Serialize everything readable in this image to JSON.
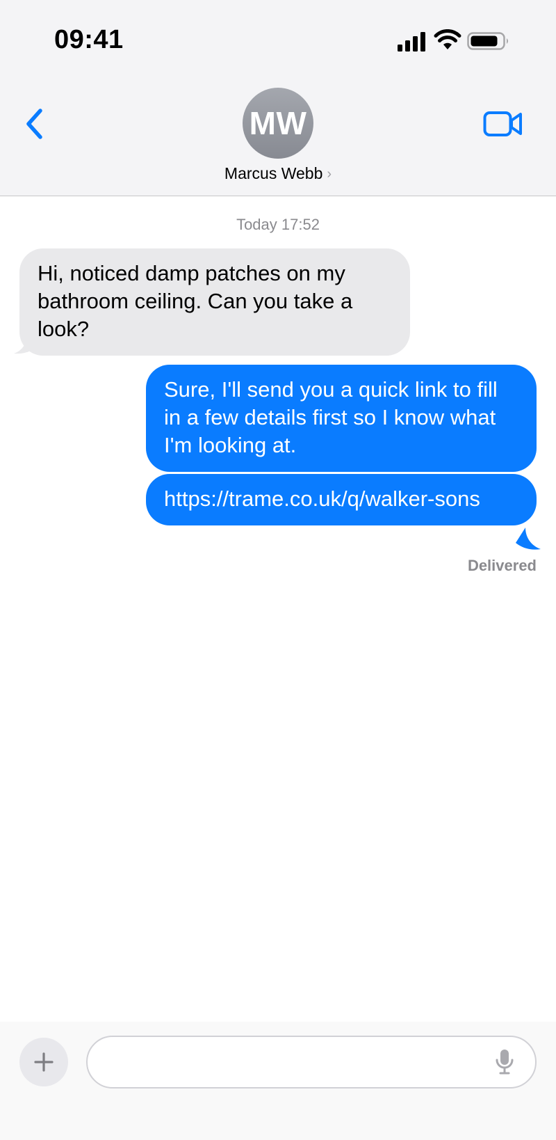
{
  "status_bar": {
    "time": "09:41",
    "icons": [
      "cellular-signal-icon",
      "wifi-icon",
      "battery-icon"
    ]
  },
  "header": {
    "back_icon": "chevron-left-icon",
    "avatar_initials": "MW",
    "contact_name": "Marcus Webb",
    "contact_chevron": "›",
    "video_icon": "video-camera-icon"
  },
  "thread": {
    "timestamp": "Today 17:52",
    "messages": [
      {
        "direction": "incoming",
        "text": "Hi, noticed damp patches on my bathroom ceiling. Can you take a look?"
      },
      {
        "direction": "outgoing",
        "text": "Sure, I'll send you a quick link to fill in a few details first so I know what I'm looking at."
      },
      {
        "direction": "outgoing",
        "text": "https://trame.co.uk/q/walker-sons"
      }
    ],
    "delivery_status": "Delivered"
  },
  "composer": {
    "plus_icon": "plus-icon",
    "input_value": "",
    "input_placeholder": "",
    "mic_icon": "microphone-icon"
  },
  "colors": {
    "accent": "#0a7cff",
    "incoming_bubble": "#e9e9eb",
    "header_bg": "#f4f4f6",
    "secondary_text": "#8a8a8e",
    "avatar": "#9a9da4"
  }
}
